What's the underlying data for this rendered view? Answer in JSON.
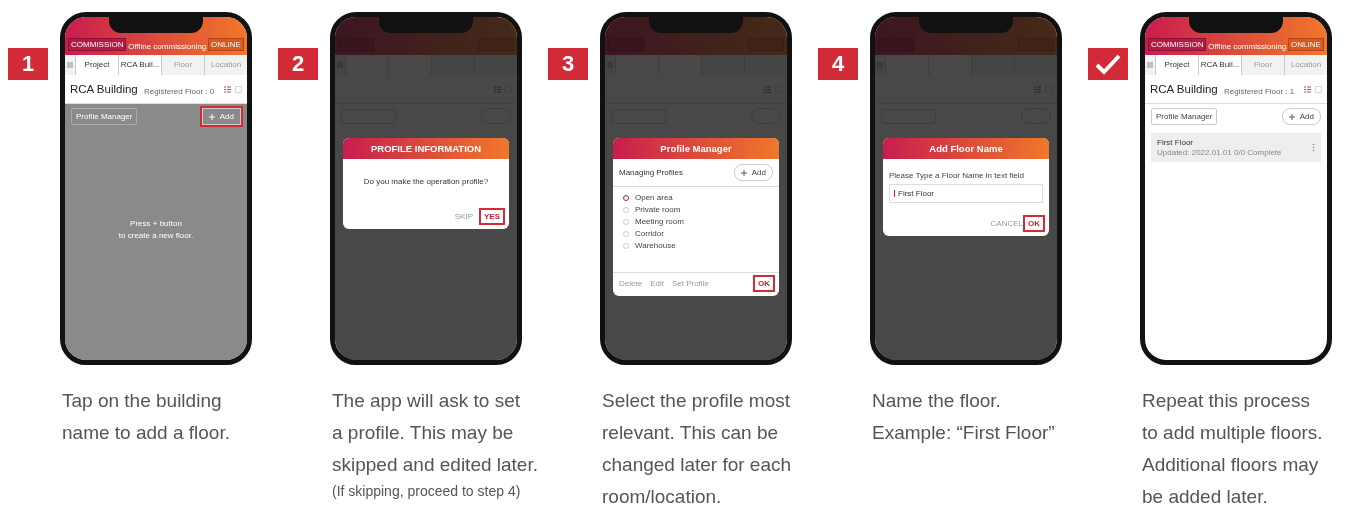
{
  "steps": [
    {
      "badge": {
        "kind": "number",
        "label": "1"
      },
      "phone": {
        "header": {
          "commission": "COMMISSION",
          "title": "Offline commissioning",
          "online": "ONLINE"
        },
        "breadcrumb": [
          {
            "label": "Project",
            "enabled": true
          },
          {
            "label": "RCA Buil...",
            "enabled": true
          },
          {
            "label": "Floor",
            "enabled": false
          },
          {
            "label": "Location",
            "enabled": false
          }
        ],
        "building": "RCA Building",
        "registered": "Registered Floor : 0",
        "toolbar": {
          "profile_manager": "Profile Manager",
          "add": "Add",
          "add_highlighted": true
        },
        "dimmed": false,
        "body_shaded": true,
        "empty_hint": [
          "Press + button",
          "to create a new floor."
        ]
      },
      "caption": [
        "Tap on the building",
        "name to add a floor."
      ]
    },
    {
      "badge": {
        "kind": "number",
        "label": "2"
      },
      "phone": {
        "dimmed": true,
        "body_shaded": false,
        "dialog": {
          "kind": "confirm",
          "title": "PROFILE INFORMATION",
          "message": "Do you make the operation profile?",
          "actions": [
            {
              "label": "SKIP",
              "highlighted": false
            },
            {
              "label": "YES",
              "highlighted": true
            }
          ]
        }
      },
      "caption": [
        "The app will ask to set",
        "a profile. This may be",
        "skipped and edited later."
      ],
      "note": "(If skipping, proceed to step 4)"
    },
    {
      "badge": {
        "kind": "number",
        "label": "3"
      },
      "phone": {
        "dimmed": true,
        "body_shaded": false,
        "dialog": {
          "kind": "profiles",
          "title": "Profile Manager",
          "subtitle": "Managing Profiles",
          "add": "Add",
          "options": [
            {
              "label": "Open area",
              "selected": true
            },
            {
              "label": "Private room",
              "selected": false
            },
            {
              "label": "Meeting room",
              "selected": false
            },
            {
              "label": "Corridor",
              "selected": false
            },
            {
              "label": "Warehouse",
              "selected": false
            }
          ],
          "actions": [
            {
              "label": "Delete",
              "highlighted": false
            },
            {
              "label": "Edit",
              "highlighted": false
            },
            {
              "label": "Set Profile",
              "highlighted": false
            },
            {
              "label": "OK",
              "highlighted": true
            }
          ]
        }
      },
      "caption": [
        "Select the profile most",
        "relevant.  This can be",
        "changed later for each",
        "room/location."
      ]
    },
    {
      "badge": {
        "kind": "number",
        "label": "4"
      },
      "phone": {
        "dimmed": true,
        "body_shaded": false,
        "dialog": {
          "kind": "input",
          "title": "Add Floor Name",
          "prompt": "Please Type a Floor Name in text field",
          "value": "First Floor",
          "actions": [
            {
              "label": "CANCEL",
              "highlighted": false
            },
            {
              "label": "OK",
              "highlighted": true
            }
          ]
        }
      },
      "caption": [
        "Name the floor.",
        "Example: “First Floor”"
      ]
    },
    {
      "badge": {
        "kind": "check"
      },
      "phone": {
        "header": {
          "commission": "COMMISSION",
          "title": "Offline commissioning",
          "online": "ONLINE"
        },
        "breadcrumb": [
          {
            "label": "Project",
            "enabled": true
          },
          {
            "label": "RCA Buil...",
            "enabled": true
          },
          {
            "label": "Floor",
            "enabled": false
          },
          {
            "label": "Location",
            "enabled": false
          }
        ],
        "building": "RCA Building",
        "registered": "Registered Floor : 1",
        "toolbar": {
          "profile_manager": "Profile Manager",
          "add": "Add",
          "add_highlighted": false
        },
        "dimmed": false,
        "body_shaded": false,
        "floors": [
          {
            "name": "First Floor",
            "meta": "Updated: 2022.01.01  0/0 Complete"
          }
        ]
      },
      "caption": [
        "Repeat this process",
        "to add multiple floors.",
        "Additional floors may",
        "be added later."
      ]
    }
  ]
}
